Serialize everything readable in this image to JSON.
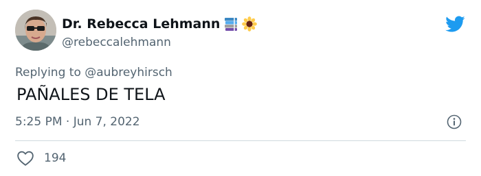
{
  "author": {
    "name": "Dr. Rebecca Lehmann",
    "handle": "@rebeccalehmann",
    "name_emojis": [
      "books-emoji",
      "sunflower-emoji"
    ]
  },
  "reply": {
    "prefix": "Replying to ",
    "mention": "@aubreyhirsch"
  },
  "tweet": {
    "text": "PAÑALES DE TELA",
    "timestamp": "5:25 PM · Jun 7, 2022"
  },
  "actions": {
    "like_count": "194"
  },
  "colors": {
    "brand_blue": "#1d9bf0",
    "secondary_text": "#536471",
    "primary_text": "#0f1419",
    "divider": "#cfd9de"
  },
  "icons": {
    "logo": "twitter-bird-icon",
    "info": "info-icon",
    "like": "heart-icon"
  }
}
